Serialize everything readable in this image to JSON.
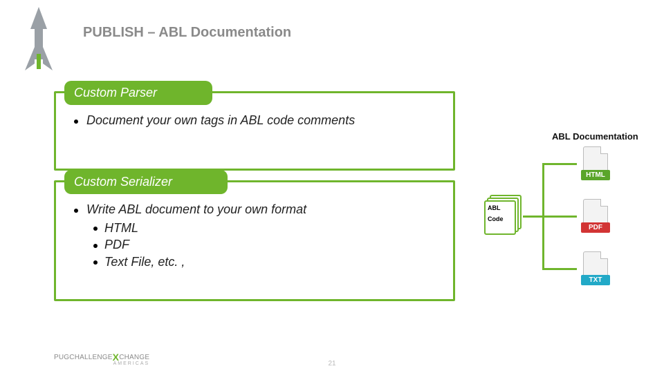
{
  "title": "PUBLISH – ABL Documentation",
  "block1": {
    "pill": "Custom Parser",
    "bullets": [
      {
        "text": "Document your own tags in ABL code comments"
      }
    ]
  },
  "block2": {
    "pill": "Custom Serializer",
    "bullets": [
      {
        "text": "Write ABL document to your own format",
        "sub": [
          "HTML",
          "PDF",
          "Text File, etc. ,"
        ]
      }
    ]
  },
  "diagram": {
    "heading": "ABL Documentation",
    "stack_line1": "ABL",
    "stack_line2": "Code",
    "out1": "HTML",
    "out2": "PDF",
    "out3": "TXT"
  },
  "page": "21",
  "footer": "PUGCHALLENGE",
  "footer2": "AMERICAS"
}
